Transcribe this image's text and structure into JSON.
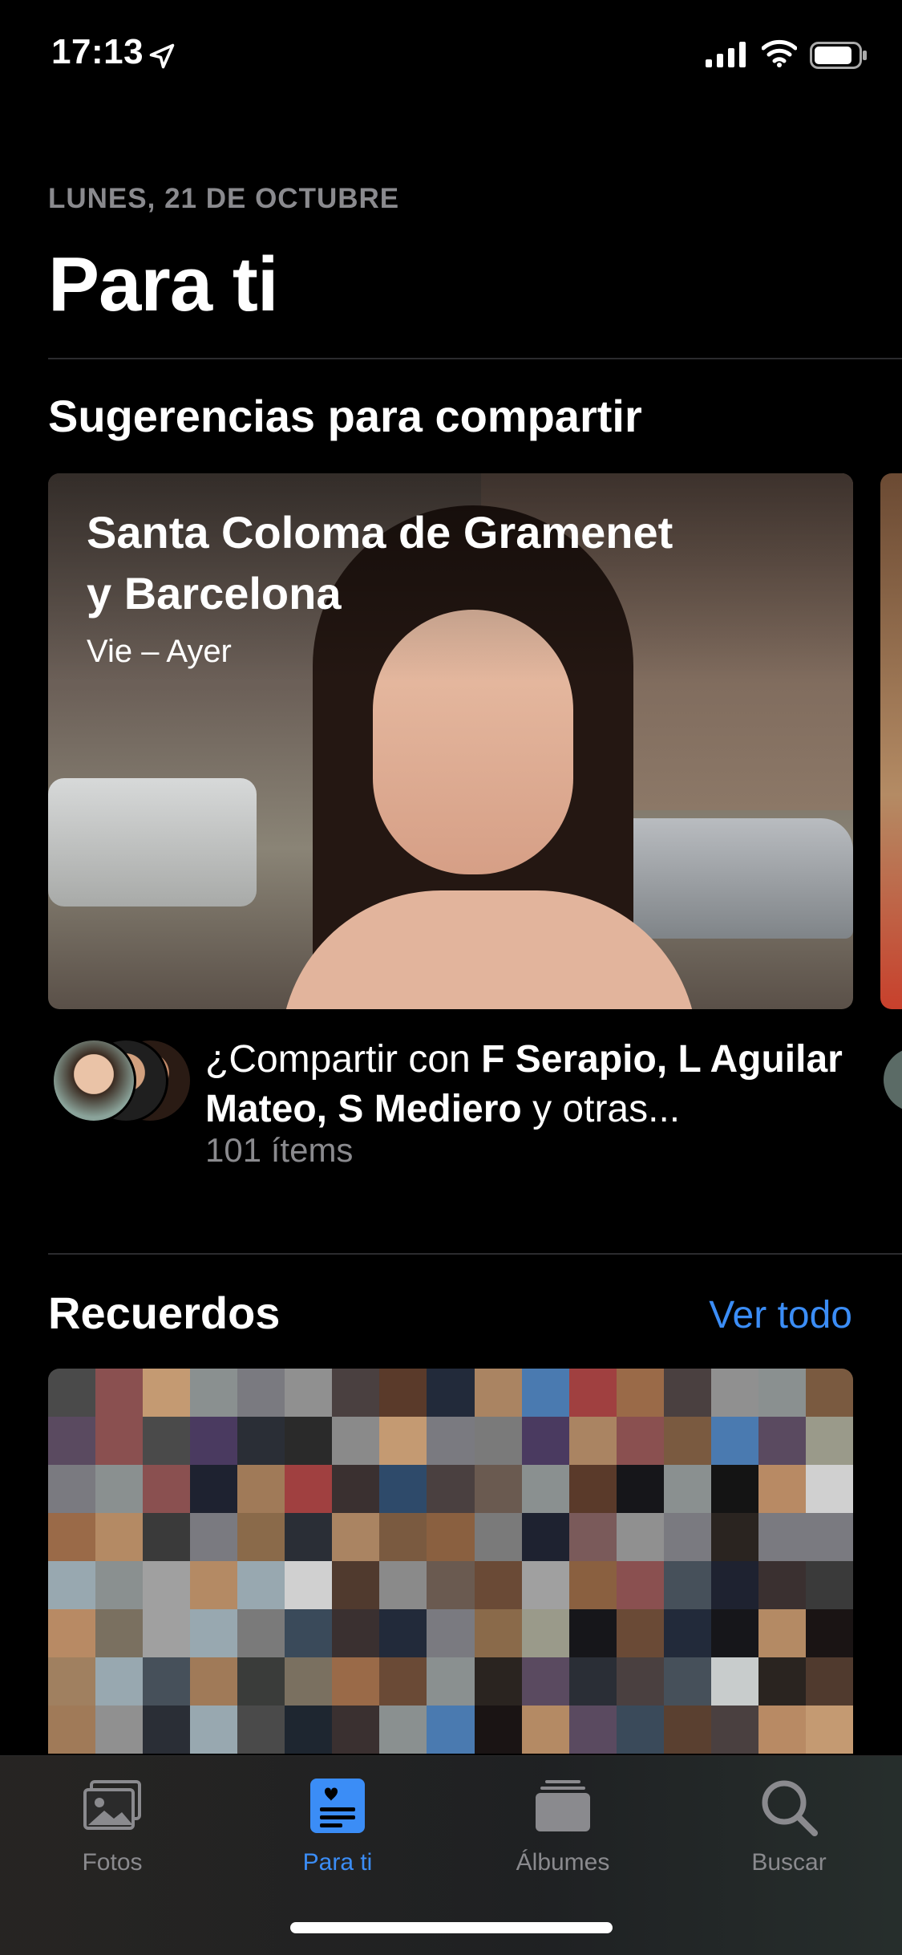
{
  "status_bar": {
    "time": "17:13"
  },
  "header": {
    "date": "LUNES, 21 DE OCTUBRE",
    "title": "Para ti"
  },
  "sharing": {
    "section_title": "Sugerencias para compartir",
    "card": {
      "title_line1": "Santa Coloma de Gramenet",
      "title_line2": "y Barcelona",
      "subtitle": "Vie – Ayer"
    },
    "prompt_prefix": "¿Compartir con ",
    "prompt_names": "F Serapio, L Aguilar Mateo, S Mediero",
    "prompt_suffix": " y otras...",
    "count": "101 ítems"
  },
  "memories": {
    "section_title": "Recuerdos",
    "see_all": "Ver todo"
  },
  "tab_bar": {
    "tabs": [
      {
        "label": "Fotos",
        "icon": "photos-icon",
        "active": false
      },
      {
        "label": "Para ti",
        "icon": "for-you-icon",
        "active": true
      },
      {
        "label": "Álbumes",
        "icon": "albums-icon",
        "active": false
      },
      {
        "label": "Buscar",
        "icon": "search-icon",
        "active": false
      }
    ]
  },
  "colors": {
    "accent": "#3b8df6",
    "background": "#000000",
    "secondary_text": "#8a8a8e"
  }
}
